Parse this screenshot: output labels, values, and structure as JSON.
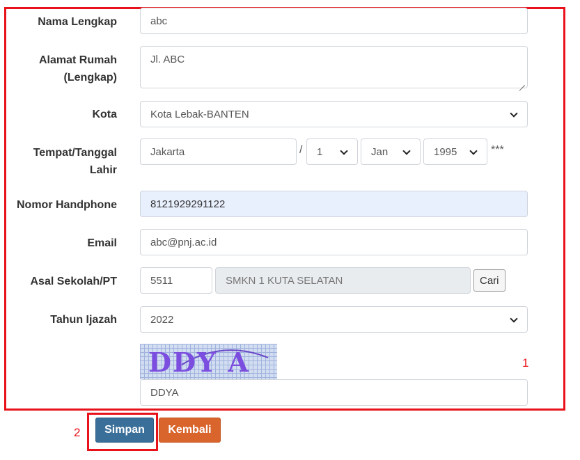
{
  "colors": {
    "highlight": "#e8131a",
    "primary_button": "#3a6f9a",
    "secondary_button": "#d9642c",
    "autofill_bg": "#e8f0fe",
    "readonly_bg": "#e9ecef"
  },
  "form": {
    "nama": {
      "label": "Nama Lengkap",
      "value": "abc"
    },
    "alamat": {
      "label_line1": "Alamat Rumah",
      "label_line2": "(Lengkap)",
      "value": "Jl. ABC"
    },
    "kota": {
      "label": "Kota",
      "selected": "Kota Lebak-BANTEN"
    },
    "ttl": {
      "label_line1": "Tempat/Tanggal",
      "label_line2": "Lahir",
      "tempat": "Jakarta",
      "separator": "/",
      "tanggal": "1",
      "bulan": "Jan",
      "tahun": "1995",
      "required_mark": "***"
    },
    "hp": {
      "label": "Nomor Handphone",
      "value": "8121929291122"
    },
    "email": {
      "label": "Email",
      "value": "abc@pnj.ac.id"
    },
    "sekolah": {
      "label": "Asal Sekolah/PT",
      "kode": "5511",
      "nama": "SMKN 1 KUTA SELATAN",
      "search_button": "Cari"
    },
    "ijazah": {
      "label": "Tahun Ijazah",
      "selected": "2022"
    },
    "captcha": {
      "image_text": "DDY A",
      "value": "DDYA"
    }
  },
  "buttons": {
    "save": "Simpan",
    "back": "Kembali"
  },
  "annotations": {
    "marker_1": "1",
    "marker_2": "2"
  }
}
